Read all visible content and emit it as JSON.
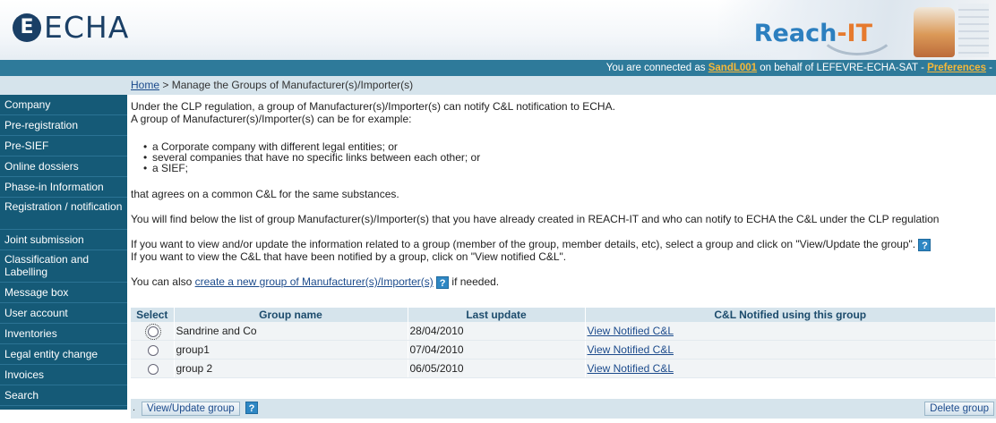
{
  "header": {
    "logo_mark": "E",
    "logo_text": "ECHA",
    "brand_main": "Reach",
    "brand_suffix": "-IT"
  },
  "status": {
    "prefix": "You are connected as ",
    "user": "SandL001",
    "middle": " on behalf of LEFEVRE-ECHA-SAT - ",
    "preferences": "Preferences",
    "suffix": " -"
  },
  "breadcrumb": {
    "home": "Home",
    "separator": " > ",
    "current": "Manage the Groups of Manufacturer(s)/Importer(s)"
  },
  "sidebar": {
    "items": [
      {
        "label": "Company"
      },
      {
        "label": "Pre-registration"
      },
      {
        "label": "Pre-SIEF"
      },
      {
        "label": "Online dossiers"
      },
      {
        "label": "Phase-in Information"
      },
      {
        "label": "Registration / notification"
      },
      {
        "label": "Joint submission"
      },
      {
        "label": "Classification and Labelling"
      },
      {
        "label": "Message box"
      },
      {
        "label": "User account"
      },
      {
        "label": "Inventories"
      },
      {
        "label": "Legal entity change"
      },
      {
        "label": "Invoices"
      },
      {
        "label": "Search"
      }
    ]
  },
  "main": {
    "intro1": "Under the CLP regulation, a group of Manufacturer(s)/Importer(s) can notify C&L notification to ECHA.",
    "intro2": "A group of Manufacturer(s)/Importer(s) can be for example:",
    "bullets": [
      "a Corporate company with different legal entities; or",
      "several companies that have no specific links between each other; or",
      "a SIEF;"
    ],
    "agrees": "that agrees on a common C&L for the same substances.",
    "list_text": "You will find below the list of group Manufacturer(s)/Importer(s) that you have already created in REACH-IT and who can notify to ECHA the C&L under the CLP regulation",
    "view_update_text": "If you want to view and/or update the information related to a group (member of the group, member details, etc), select a group and click on \"View/Update the group\".",
    "view_notified_text": "If you want to view the C&L that have been notified by a group, click on \"View notified C&L\".",
    "create_prefix": "You can also ",
    "create_link": "create a new group of Manufacturer(s)/Importer(s)",
    "create_suffix": " if needed.",
    "help_glyph": "?"
  },
  "table": {
    "columns": [
      "Select",
      "Group name",
      "Last update",
      "C&L Notified using this group"
    ],
    "rows": [
      {
        "name": "Sandrine and Co",
        "last_update": "28/04/2010",
        "link": "View Notified C&L"
      },
      {
        "name": "group1",
        "last_update": "07/04/2010",
        "link": "View Notified C&L"
      },
      {
        "name": "group 2",
        "last_update": "06/05/2010",
        "link": "View Notified C&L"
      }
    ]
  },
  "actions": {
    "dot": ".",
    "view_update": "View/Update group",
    "help": "?",
    "delete": "Delete group"
  },
  "colors": {
    "sidebar_bg": "#155a77",
    "statusbar_bg": "#2e7a9a",
    "header_band": "#d6e4ec",
    "link": "#1c4b8c",
    "accent_orange": "#f5b83a"
  }
}
